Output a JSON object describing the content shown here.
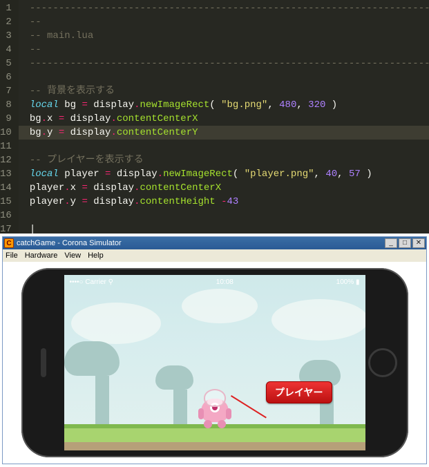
{
  "editor": {
    "lines": [
      {
        "n": 1,
        "seg": [
          {
            "c": "com",
            "t": "-----------------------------------------------------------------------------------------"
          }
        ]
      },
      {
        "n": 2,
        "seg": [
          {
            "c": "com",
            "t": "--"
          }
        ]
      },
      {
        "n": 3,
        "seg": [
          {
            "c": "com",
            "t": "-- main.lua"
          }
        ]
      },
      {
        "n": 4,
        "seg": [
          {
            "c": "com",
            "t": "--"
          }
        ]
      },
      {
        "n": 5,
        "seg": [
          {
            "c": "com",
            "t": "-----------------------------------------------------------------------------------------"
          }
        ]
      },
      {
        "n": 6,
        "seg": []
      },
      {
        "n": 7,
        "seg": [
          {
            "c": "com",
            "t": "-- 背景を表示する"
          }
        ]
      },
      {
        "n": 8,
        "seg": [
          {
            "c": "kw",
            "t": "local"
          },
          {
            "c": "id",
            "t": " bg "
          },
          {
            "c": "op",
            "t": "="
          },
          {
            "c": "id",
            "t": " display"
          },
          {
            "c": "op",
            "t": "."
          },
          {
            "c": "prop",
            "t": "newImageRect"
          },
          {
            "c": "id",
            "t": "( "
          },
          {
            "c": "str",
            "t": "\"bg.png\""
          },
          {
            "c": "id",
            "t": ", "
          },
          {
            "c": "num",
            "t": "480"
          },
          {
            "c": "id",
            "t": ", "
          },
          {
            "c": "num",
            "t": "320"
          },
          {
            "c": "id",
            "t": " )"
          }
        ]
      },
      {
        "n": 9,
        "seg": [
          {
            "c": "id",
            "t": "bg"
          },
          {
            "c": "op",
            "t": "."
          },
          {
            "c": "id",
            "t": "x "
          },
          {
            "c": "op",
            "t": "="
          },
          {
            "c": "id",
            "t": " display"
          },
          {
            "c": "op",
            "t": "."
          },
          {
            "c": "prop",
            "t": "contentCenterX"
          }
        ]
      },
      {
        "n": 10,
        "hl": true,
        "seg": [
          {
            "c": "id",
            "t": "bg"
          },
          {
            "c": "op",
            "t": "."
          },
          {
            "c": "id",
            "t": "y "
          },
          {
            "c": "op",
            "t": "="
          },
          {
            "c": "id",
            "t": " display"
          },
          {
            "c": "op",
            "t": "."
          },
          {
            "c": "prop",
            "t": "contentCenterY"
          }
        ]
      },
      {
        "n": 11,
        "seg": []
      },
      {
        "n": 12,
        "seg": [
          {
            "c": "com",
            "t": "-- プレイヤーを表示する"
          }
        ]
      },
      {
        "n": 13,
        "seg": [
          {
            "c": "kw",
            "t": "local"
          },
          {
            "c": "id",
            "t": " player "
          },
          {
            "c": "op",
            "t": "="
          },
          {
            "c": "id",
            "t": " display"
          },
          {
            "c": "op",
            "t": "."
          },
          {
            "c": "prop",
            "t": "newImageRect"
          },
          {
            "c": "id",
            "t": "( "
          },
          {
            "c": "str",
            "t": "\"player.png\""
          },
          {
            "c": "id",
            "t": ", "
          },
          {
            "c": "num",
            "t": "40"
          },
          {
            "c": "id",
            "t": ", "
          },
          {
            "c": "num",
            "t": "57"
          },
          {
            "c": "id",
            "t": " )"
          }
        ]
      },
      {
        "n": 14,
        "seg": [
          {
            "c": "id",
            "t": "player"
          },
          {
            "c": "op",
            "t": "."
          },
          {
            "c": "id",
            "t": "x "
          },
          {
            "c": "op",
            "t": "="
          },
          {
            "c": "id",
            "t": " display"
          },
          {
            "c": "op",
            "t": "."
          },
          {
            "c": "prop",
            "t": "contentCenterX"
          }
        ]
      },
      {
        "n": 15,
        "seg": [
          {
            "c": "id",
            "t": "player"
          },
          {
            "c": "op",
            "t": "."
          },
          {
            "c": "id",
            "t": "y "
          },
          {
            "c": "op",
            "t": "="
          },
          {
            "c": "id",
            "t": " display"
          },
          {
            "c": "op",
            "t": "."
          },
          {
            "c": "prop",
            "t": "contentHeight"
          },
          {
            "c": "id",
            "t": " "
          },
          {
            "c": "op",
            "t": "-"
          },
          {
            "c": "num",
            "t": "43"
          }
        ]
      },
      {
        "n": 16,
        "seg": []
      },
      {
        "n": 17,
        "seg": [
          {
            "c": "id",
            "t": "|"
          }
        ]
      }
    ]
  },
  "sim": {
    "title": "catchGame - Corona Simulator",
    "icon_letter": "C",
    "menus": [
      "File",
      "Hardware",
      "View",
      "Help"
    ],
    "winbtns": {
      "min": "_",
      "max": "□",
      "close": "✕"
    },
    "status": {
      "carrier": "••••○ Carrier ⚲",
      "time": "10:08",
      "batt": "100% ▮"
    },
    "callout_label": "プレイヤー"
  }
}
